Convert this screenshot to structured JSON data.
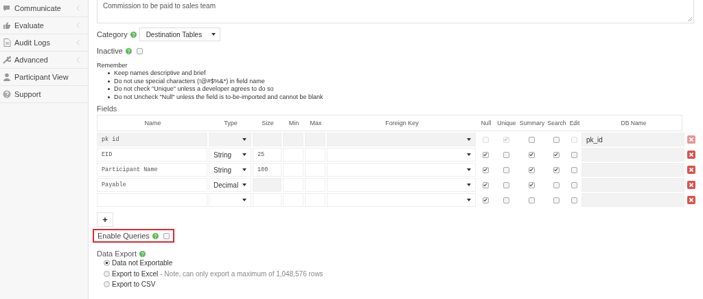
{
  "sidebar": {
    "items": [
      {
        "label": "Communicate",
        "expandable": true
      },
      {
        "label": "Evaluate",
        "expandable": true
      },
      {
        "label": "Audit Logs",
        "expandable": true
      },
      {
        "label": "Advanced",
        "expandable": true
      },
      {
        "label": "Participant View",
        "expandable": false
      },
      {
        "label": "Support",
        "expandable": false
      }
    ]
  },
  "description": {
    "value": "Commission to be paid to sales team"
  },
  "category": {
    "label": "Category",
    "value": "Destination Tables"
  },
  "inactive": {
    "label": "Inactive",
    "checked": false
  },
  "remember": {
    "title": "Remember",
    "items": [
      "Keep names descriptive and brief",
      "Do not use special characters (!@#$%&*) in field name",
      "Do not check \"Unique\" unless a developer agrees to do so",
      "Do not Uncheck \"Null\" unless the field is to-be-imported and cannot be blank"
    ]
  },
  "fields": {
    "title": "Fields",
    "columns": [
      "Name",
      "Type",
      "Size",
      "Min",
      "Max",
      "Foreign Key",
      "Null",
      "Unique",
      "Summary",
      "Search",
      "Edit",
      "DB Name"
    ],
    "rows": [
      {
        "name": "pk id",
        "type": "",
        "size": "",
        "locked": true,
        "null": false,
        "unique": true,
        "summary": false,
        "search": false,
        "edit": false,
        "db_name": "pk_id"
      },
      {
        "name": "EID",
        "type": "String",
        "size": "25",
        "locked": false,
        "null": true,
        "unique": false,
        "summary": true,
        "search": true,
        "edit": false,
        "db_name": ""
      },
      {
        "name": "Participant Name",
        "type": "String",
        "size": "100",
        "locked": false,
        "null": true,
        "unique": false,
        "summary": true,
        "search": true,
        "edit": false,
        "db_name": ""
      },
      {
        "name": "Payable",
        "type": "Decimal",
        "size": "",
        "locked": false,
        "null": true,
        "unique": false,
        "summary": true,
        "search": false,
        "edit": false,
        "db_name": ""
      },
      {
        "name": "",
        "type": "",
        "size": "",
        "locked": false,
        "null": true,
        "unique": false,
        "summary": false,
        "search": false,
        "edit": false,
        "db_name": ""
      }
    ]
  },
  "add_button": {
    "label": "+"
  },
  "enable_queries": {
    "label": "Enable Queries",
    "checked": false,
    "highlighted": true
  },
  "data_export": {
    "title": "Data Export",
    "options": [
      {
        "label": "Data not Exportable",
        "selected": true
      },
      {
        "label": "Export to Excel",
        "note": "- Note, can only export a maximum of 1,048,576 rows",
        "selected": false
      },
      {
        "label": "Export to CSV",
        "selected": false
      }
    ]
  }
}
